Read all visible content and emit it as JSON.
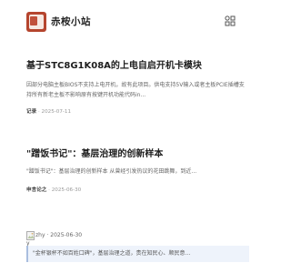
{
  "header": {
    "site_title": "赤桉小站",
    "logo_icon": "site-logo-icon",
    "menu_icon": "grid-menu-icon"
  },
  "posts": [
    {
      "title": "基于STC8G1K08A的上电自启开机卡模块",
      "excerpt": "因部分电脑主板BIOS不支持上电开机，故有此项目。供电支持5V输入或者主板PCIE插槽支持所有新老主板不影响原有按键开机功能代码in...",
      "author": "记录",
      "date": "· 2025-07-11"
    },
    {
      "title": "\"蹭饭书记\"：基层治理的创新样本",
      "excerpt": "\"蹭饭书记\"：基层治理的创新样本     从曾经引发热议的花田跳舞，到近...",
      "author": "申言论之",
      "date": "· 2025-06-30"
    }
  ],
  "comment": {
    "author": "zhy",
    "date": "· 2025-06-30",
    "avatar_label": "zhy",
    "avatar_caption": "y",
    "quote": "\"金杯银杯不如百姓口碑\"，基层治理之道，贵在知民心、顺民意..."
  }
}
